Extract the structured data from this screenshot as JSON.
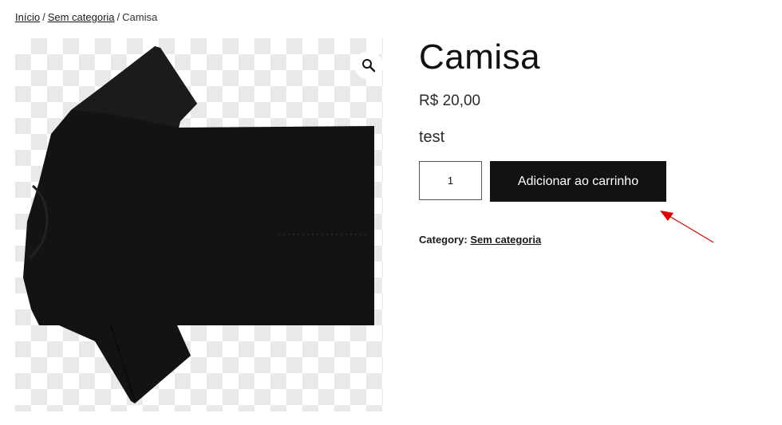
{
  "breadcrumb": {
    "home": "Início",
    "separator": "/",
    "category": "Sem categoria",
    "current": "Camisa"
  },
  "product": {
    "title": "Camisa",
    "price": "R$ 20,00",
    "short_description": "test",
    "quantity": "1",
    "add_to_cart_label": "Adicionar ao carrinho",
    "category_label": "Category:",
    "category_value": "Sem categoria"
  },
  "gallery": {
    "zoom_icon": "magnifier-icon",
    "image": "black-tshirt"
  },
  "colors": {
    "button_bg": "#121212",
    "annotation_arrow": "#e00000"
  }
}
